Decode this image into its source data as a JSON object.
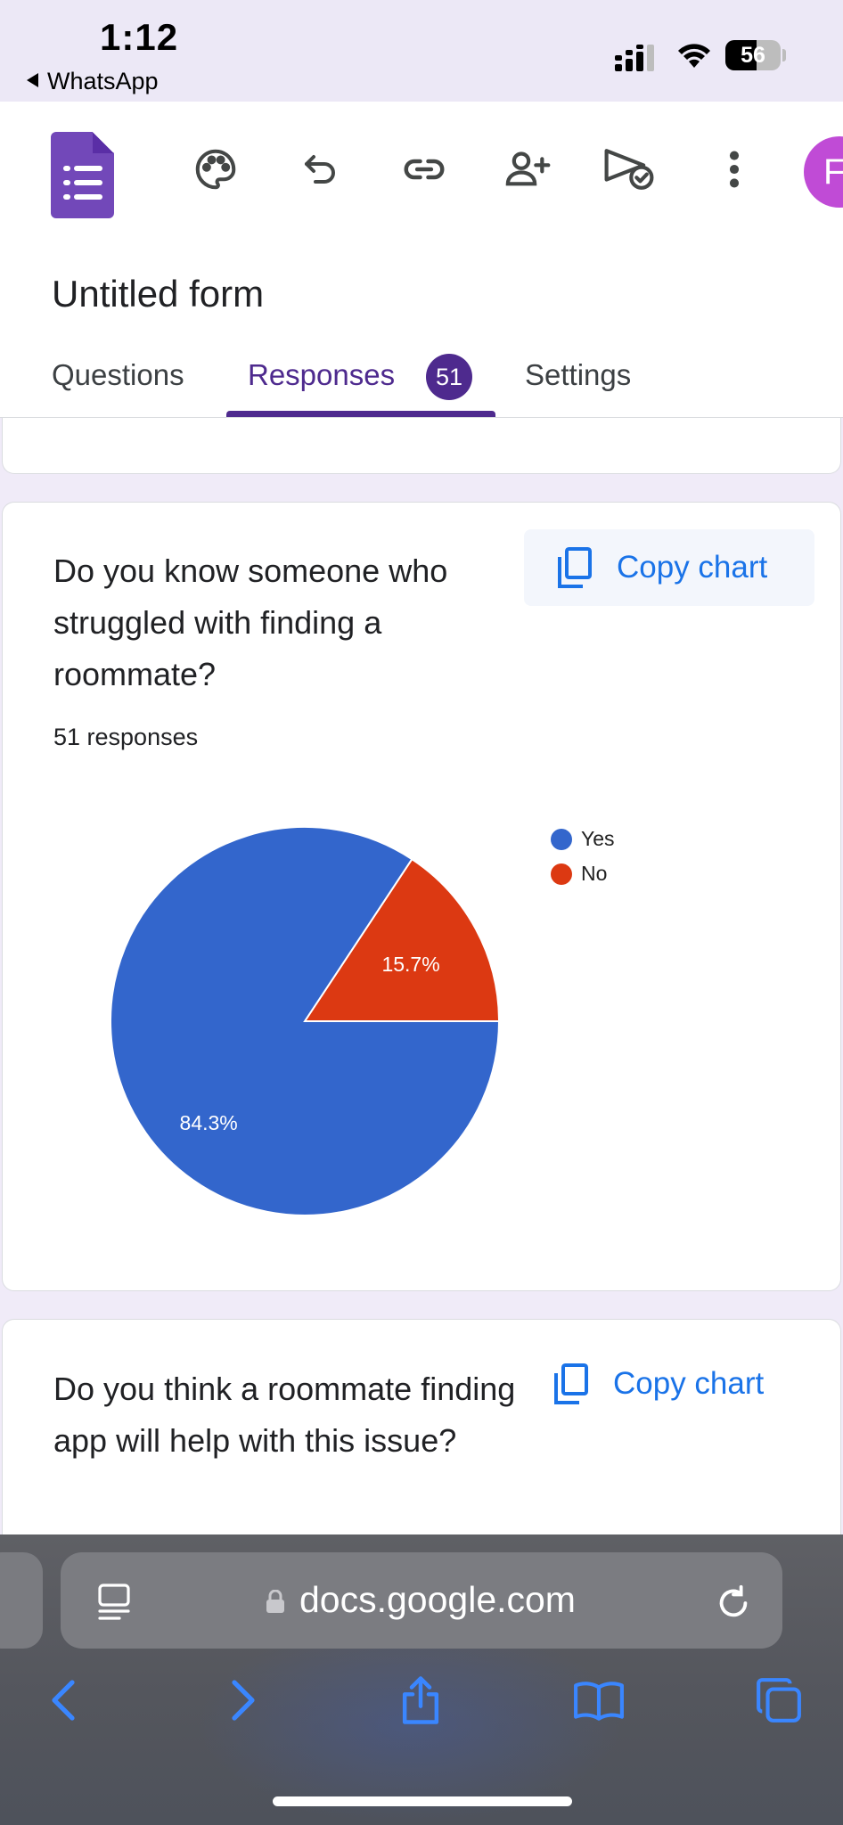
{
  "status_bar": {
    "time": "1:12",
    "back_app": "WhatsApp",
    "battery_level": "56",
    "battery_fraction": 0.56
  },
  "app": {
    "form_title": "Untitled form",
    "tabs": [
      {
        "label": "Questions"
      },
      {
        "label": "Responses",
        "badge": "51"
      },
      {
        "label": "Settings"
      }
    ],
    "avatar_letter": "F",
    "toolbar_icons": [
      "palette-icon",
      "undo-icon",
      "link-icon",
      "add-collaborator-icon",
      "send-icon",
      "more-vert-icon"
    ]
  },
  "cards": [
    {
      "question": "Do you know someone who struggled with finding a roommate?",
      "responses": "51 responses",
      "copy_label": "Copy chart",
      "chart_data": {
        "type": "pie",
        "slices": [
          {
            "label": "Yes",
            "value": 84.3,
            "display": "84.3%",
            "color": "#3366cc"
          },
          {
            "label": "No",
            "value": 15.7,
            "display": "15.7%",
            "color": "#dc3912"
          }
        ],
        "legend_position": "right"
      }
    },
    {
      "question": "Do you think a roommate finding app will help with this issue?",
      "copy_label": "Copy chart"
    }
  ],
  "browser": {
    "url": "docs.google.com",
    "nav_icons": [
      "back-icon",
      "forward-icon",
      "share-icon",
      "bookmarks-icon",
      "tabs-icon"
    ]
  },
  "colors": {
    "accent": "#4e2a8e",
    "link_blue": "#1a73e8",
    "background": "#f0ebf8"
  }
}
